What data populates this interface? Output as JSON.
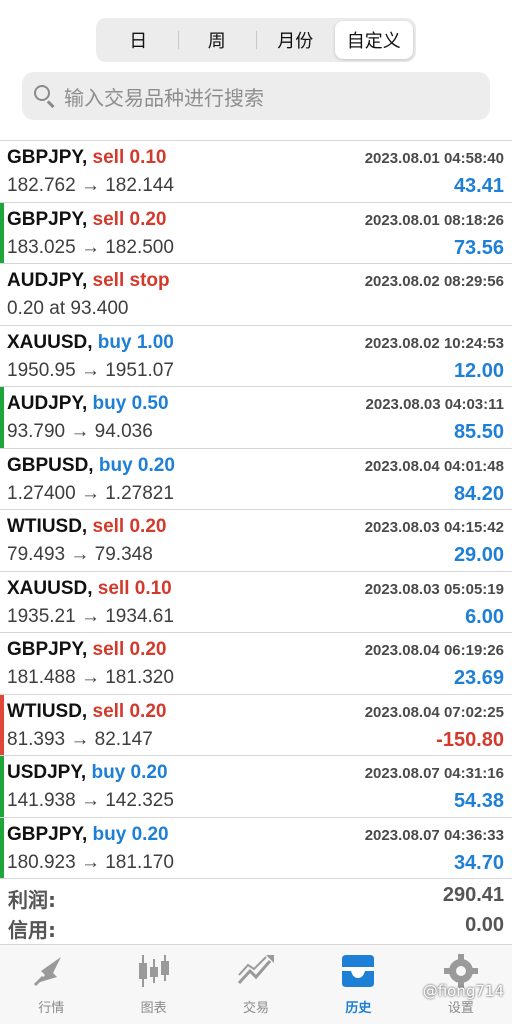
{
  "period_tabs": [
    {
      "label": "日"
    },
    {
      "label": "周"
    },
    {
      "label": "月份"
    },
    {
      "label": "自定义"
    }
  ],
  "active_period": "自定义",
  "search": {
    "placeholder": "输入交易品种进行搜索"
  },
  "trades": [
    {
      "symbol": "GBPJPY,",
      "side": "sell 0.10",
      "side_type": "sell",
      "time": "2023.08.01 04:58:40",
      "prices": "182.762 → 182.144",
      "profit": "43.41",
      "profit_type": "pos",
      "marker": "none"
    },
    {
      "symbol": "GBPJPY,",
      "side": "sell 0.20",
      "side_type": "sell",
      "time": "2023.08.01 08:18:26",
      "prices": "183.025 → 182.500",
      "profit": "73.56",
      "profit_type": "pos",
      "marker": "green"
    },
    {
      "symbol": "AUDJPY,",
      "side": "sell stop",
      "side_type": "sell",
      "time": "2023.08.02 08:29:56",
      "prices": "0.20 at 93.400",
      "profit": "",
      "profit_type": "pos",
      "marker": "none"
    },
    {
      "symbol": "XAUUSD,",
      "side": "buy 1.00",
      "side_type": "buy",
      "time": "2023.08.02 10:24:53",
      "prices": "1950.95 → 1951.07",
      "profit": "12.00",
      "profit_type": "pos",
      "marker": "none"
    },
    {
      "symbol": "AUDJPY,",
      "side": "buy 0.50",
      "side_type": "buy",
      "time": "2023.08.03 04:03:11",
      "prices": "93.790 → 94.036",
      "profit": "85.50",
      "profit_type": "pos",
      "marker": "green"
    },
    {
      "symbol": "GBPUSD,",
      "side": "buy 0.20",
      "side_type": "buy",
      "time": "2023.08.04 04:01:48",
      "prices": "1.27400 → 1.27821",
      "profit": "84.20",
      "profit_type": "pos",
      "marker": "none"
    },
    {
      "symbol": "WTIUSD,",
      "side": "sell 0.20",
      "side_type": "sell",
      "time": "2023.08.03 04:15:42",
      "prices": "79.493 → 79.348",
      "profit": "29.00",
      "profit_type": "pos",
      "marker": "none"
    },
    {
      "symbol": "XAUUSD,",
      "side": "sell 0.10",
      "side_type": "sell",
      "time": "2023.08.03 05:05:19",
      "prices": "1935.21 → 1934.61",
      "profit": "6.00",
      "profit_type": "pos",
      "marker": "none"
    },
    {
      "symbol": "GBPJPY,",
      "side": "sell 0.20",
      "side_type": "sell",
      "time": "2023.08.04 06:19:26",
      "prices": "181.488 → 181.320",
      "profit": "23.69",
      "profit_type": "pos",
      "marker": "none"
    },
    {
      "symbol": "WTIUSD,",
      "side": "sell 0.20",
      "side_type": "sell",
      "time": "2023.08.04 07:02:25",
      "prices": "81.393 → 82.147",
      "profit": "-150.80",
      "profit_type": "neg",
      "marker": "red"
    },
    {
      "symbol": "USDJPY,",
      "side": "buy 0.20",
      "side_type": "buy",
      "time": "2023.08.07 04:31:16",
      "prices": "141.938 → 142.325",
      "profit": "54.38",
      "profit_type": "pos",
      "marker": "green"
    },
    {
      "symbol": "GBPJPY,",
      "side": "buy 0.20",
      "side_type": "buy",
      "time": "2023.08.07 04:36:33",
      "prices": "180.923 → 181.170",
      "profit": "34.70",
      "profit_type": "pos",
      "marker": "green"
    }
  ],
  "summary": {
    "profit_label": "利润:",
    "profit_value": "290.41",
    "credit_label": "信用:",
    "credit_value": "0.00"
  },
  "tabbar": [
    {
      "label": "行情",
      "icon": "quotes-icon"
    },
    {
      "label": "图表",
      "icon": "chart-icon"
    },
    {
      "label": "交易",
      "icon": "trade-icon"
    },
    {
      "label": "历史",
      "icon": "history-icon"
    },
    {
      "label": "设置",
      "icon": "settings-icon"
    }
  ],
  "active_tab": "历史",
  "watermark": "@fiong714",
  "colors": {
    "sell": "#d33a2c",
    "buy": "#1e7fd6",
    "profit_positive": "#1e7fd6",
    "profit_negative": "#d33a2c",
    "marker_green": "#1fa63b",
    "marker_red": "#e0463a",
    "tab_active": "#1e7fd6",
    "tab_inactive": "#8a8a8a"
  }
}
